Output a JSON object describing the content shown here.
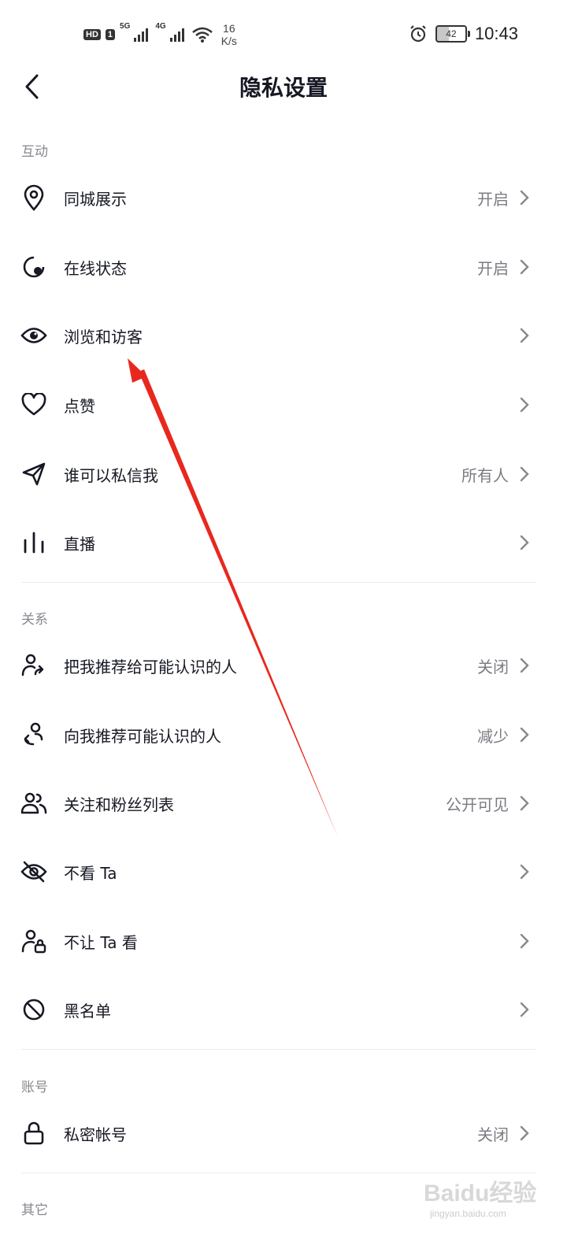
{
  "status_bar": {
    "badge_hd": "HD",
    "badge_sim": "1",
    "net1": "5G",
    "net2": "4G",
    "speed_value": "16",
    "speed_unit": "K/s",
    "battery": "42",
    "time": "10:43"
  },
  "header": {
    "title": "隐私设置"
  },
  "sections": {
    "interaction": {
      "label": "互动",
      "items": [
        {
          "label": "同城展示",
          "value": "开启",
          "icon": "location-pin-icon"
        },
        {
          "label": "在线状态",
          "value": "开启",
          "icon": "online-status-icon"
        },
        {
          "label": "浏览和访客",
          "value": "",
          "icon": "eye-icon"
        },
        {
          "label": "点赞",
          "value": "",
          "icon": "heart-icon"
        },
        {
          "label": "谁可以私信我",
          "value": "所有人",
          "icon": "send-icon"
        },
        {
          "label": "直播",
          "value": "",
          "icon": "live-bars-icon"
        }
      ]
    },
    "relations": {
      "label": "关系",
      "items": [
        {
          "label": "把我推荐给可能认识的人",
          "value": "关闭",
          "icon": "user-share-icon"
        },
        {
          "label": "向我推荐可能认识的人",
          "value": "减少",
          "icon": "user-recommend-icon"
        },
        {
          "label": "关注和粉丝列表",
          "value": "公开可见",
          "icon": "users-icon"
        },
        {
          "label": "不看 Ta",
          "value": "",
          "icon": "eye-off-icon"
        },
        {
          "label": "不让 Ta 看",
          "value": "",
          "icon": "user-lock-icon"
        },
        {
          "label": "黑名单",
          "value": "",
          "icon": "block-icon"
        }
      ]
    },
    "account": {
      "label": "账号",
      "items": [
        {
          "label": "私密帐号",
          "value": "关闭",
          "icon": "lock-icon"
        }
      ]
    },
    "other": {
      "label": "其它"
    }
  },
  "watermark": {
    "brand": "Baidu经验",
    "url": "jingyan.baidu.com"
  },
  "colors": {
    "text": "#161823",
    "secondary": "#7a7c82",
    "section": "#86888e",
    "arrow": "#e8281e"
  }
}
